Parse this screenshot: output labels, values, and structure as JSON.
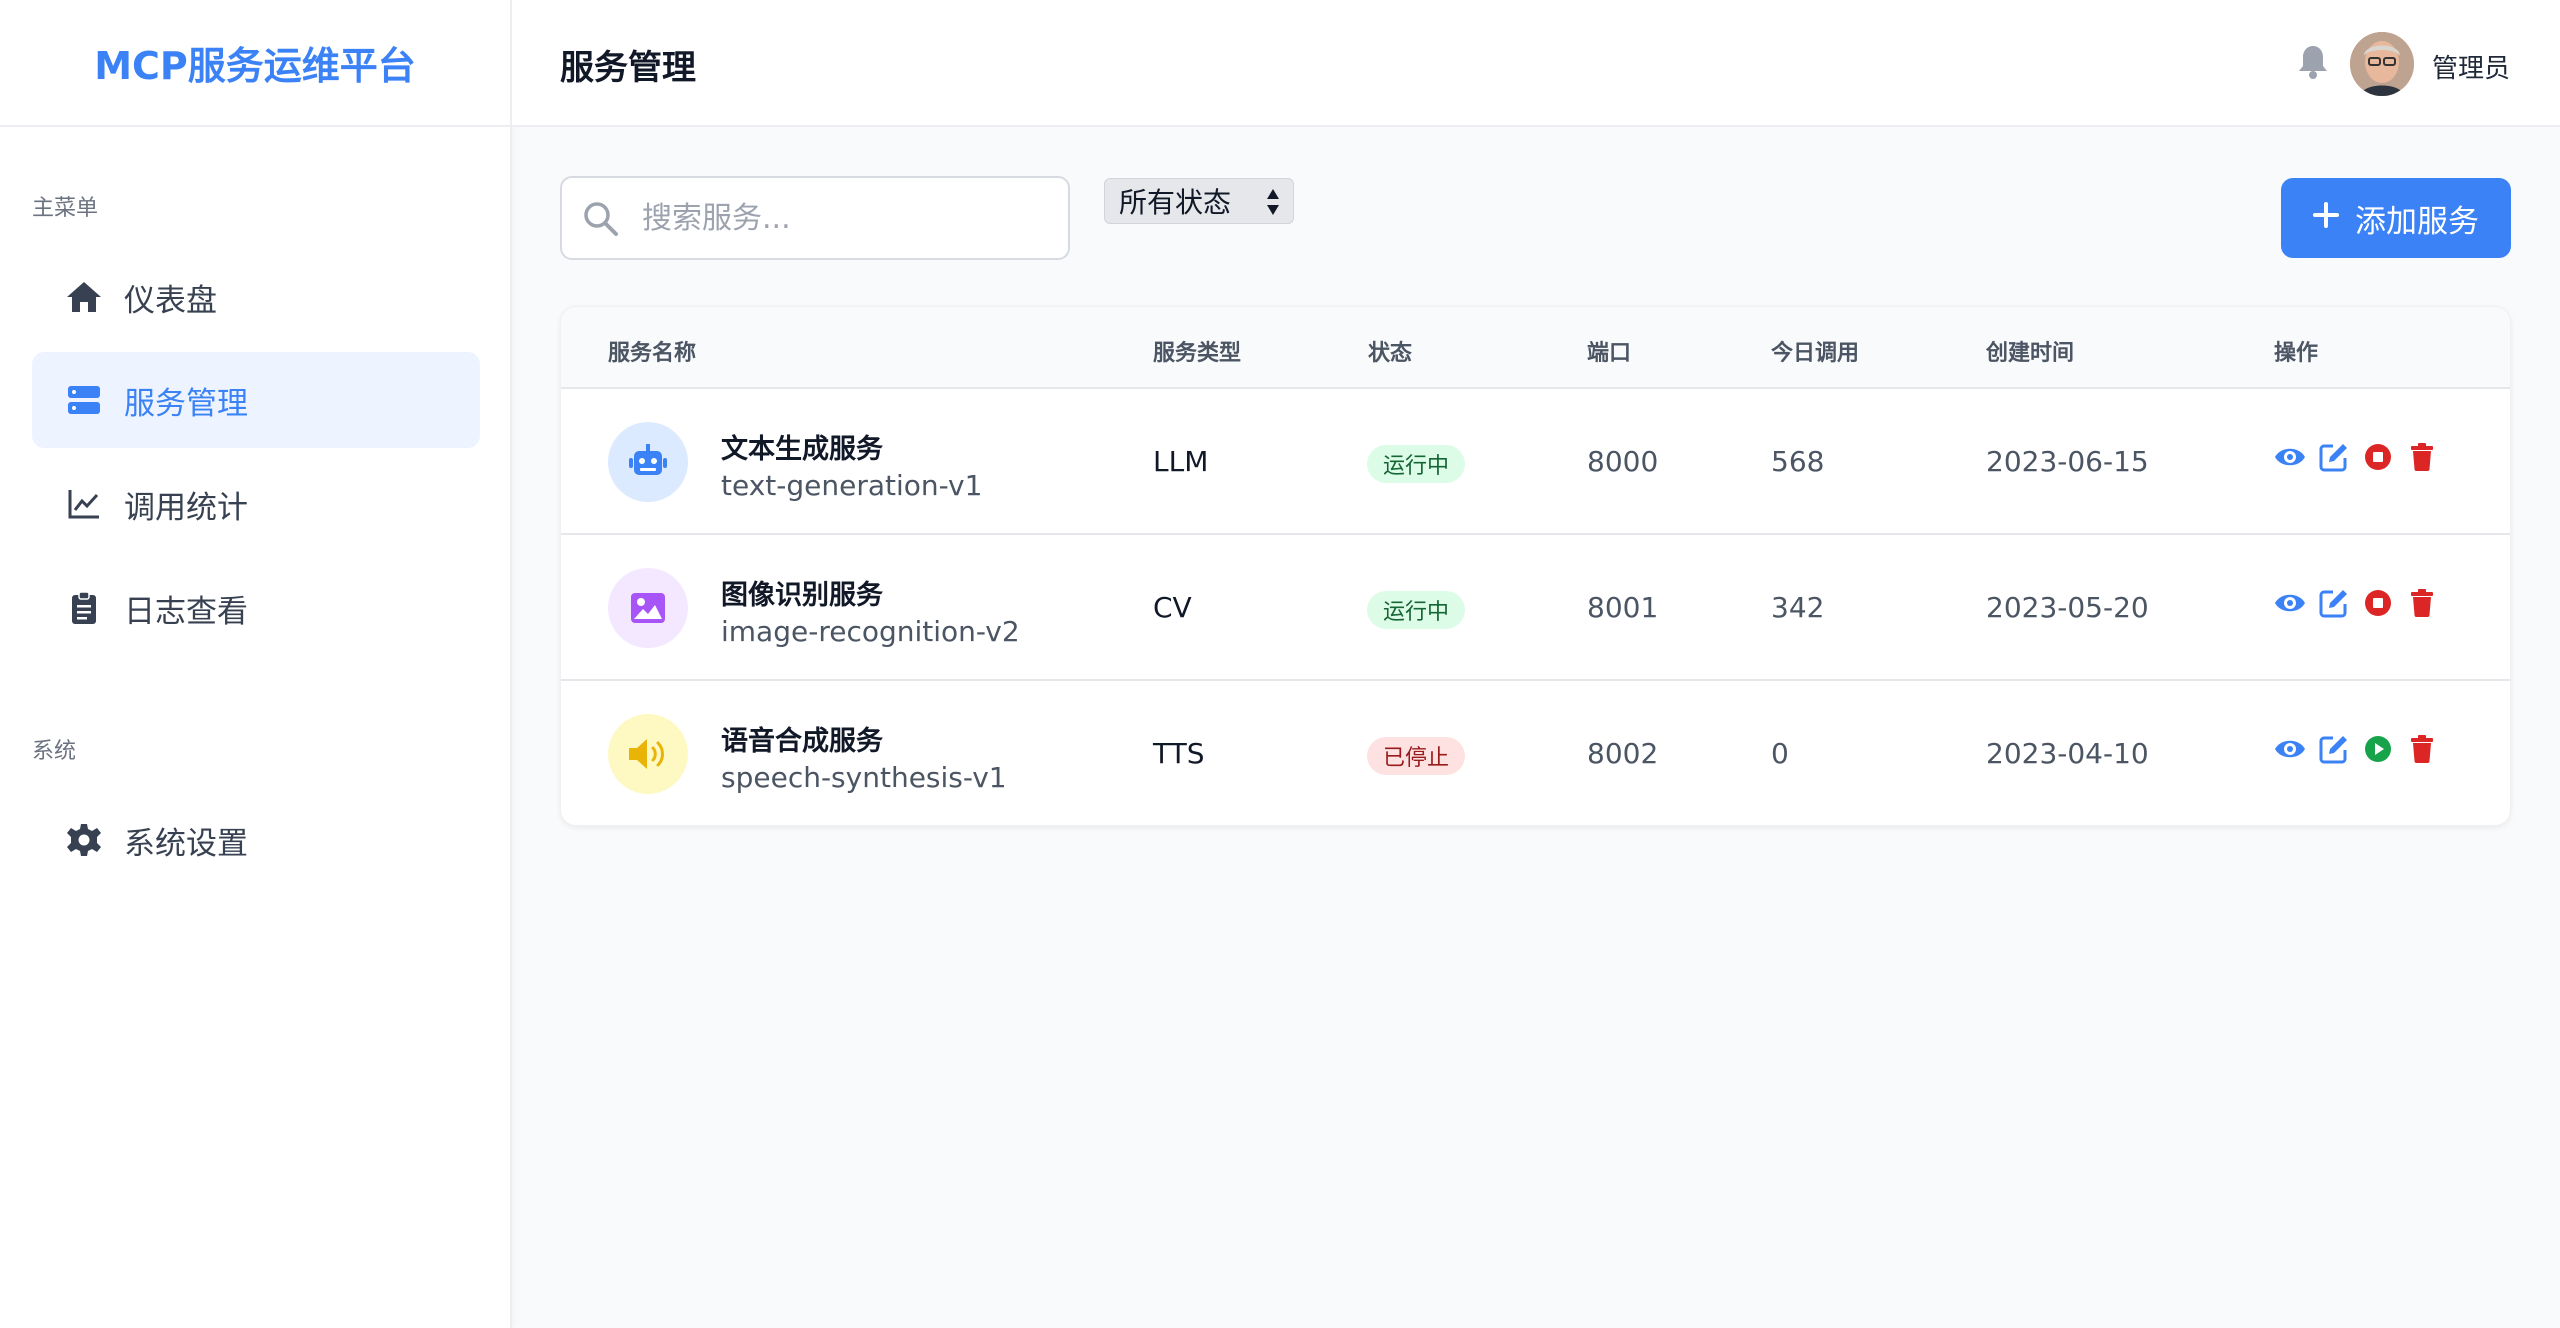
{
  "brand": {
    "title": "MCP服务运维平台"
  },
  "sidebar": {
    "main_label": "主菜单",
    "system_label": "系统",
    "items": [
      {
        "label": "仪表盘",
        "icon": "home-icon"
      },
      {
        "label": "服务管理",
        "icon": "server-icon",
        "active": true
      },
      {
        "label": "调用统计",
        "icon": "chart-line-icon"
      },
      {
        "label": "日志查看",
        "icon": "clipboard-icon"
      }
    ],
    "system_items": [
      {
        "label": "系统设置",
        "icon": "gear-icon"
      }
    ]
  },
  "header": {
    "title": "服务管理",
    "user_name": "管理员"
  },
  "toolbar": {
    "search_placeholder": "搜索服务...",
    "status_filter": "所有状态",
    "add_label": "添加服务"
  },
  "table": {
    "headers": [
      "服务名称",
      "服务类型",
      "状态",
      "端口",
      "今日调用",
      "创建时间",
      "操作"
    ],
    "rows": [
      {
        "name": "文本生成服务",
        "id": "text-generation-v1",
        "type": "LLM",
        "status": "运行中",
        "port": "8000",
        "calls": "568",
        "created": "2023-06-15",
        "icon": "robot-icon"
      },
      {
        "name": "图像识别服务",
        "id": "image-recognition-v2",
        "type": "CV",
        "status": "运行中",
        "port": "8001",
        "calls": "342",
        "created": "2023-05-20",
        "icon": "image-icon"
      },
      {
        "name": "语音合成服务",
        "id": "speech-synthesis-v1",
        "type": "TTS",
        "status": "已停止",
        "port": "8002",
        "calls": "0",
        "created": "2023-04-10",
        "icon": "speaker-icon"
      }
    ]
  },
  "colors": {
    "accent": "#3b82f6",
    "running_bg": "#dcfce7",
    "running_text": "#166534",
    "stopped_bg": "#fee2e2",
    "stopped_text": "#991b1b",
    "stop_icon": "#dc2626",
    "play_icon": "#16a34a"
  }
}
